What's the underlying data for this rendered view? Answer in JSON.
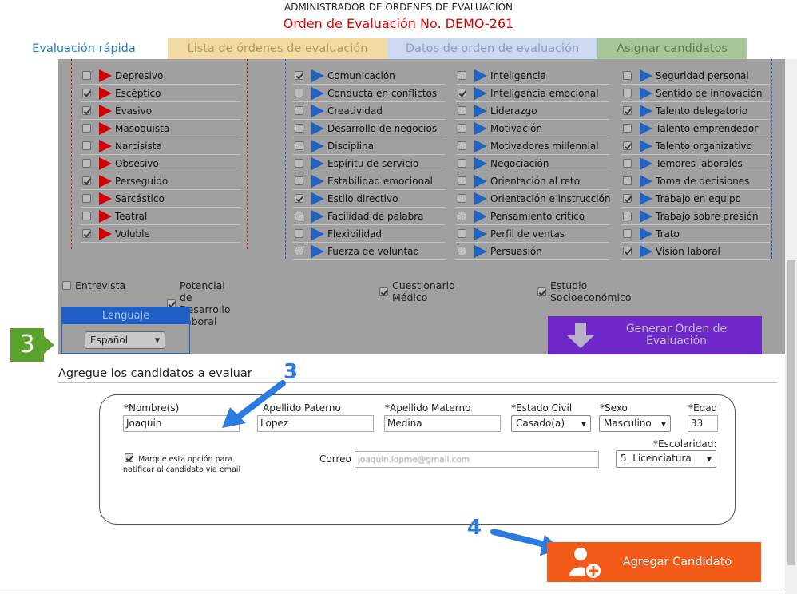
{
  "header": {
    "admin_title": "ADMINISTRADOR DE ORDENES DE EVALUACIÓN",
    "order_title": "Orden de Evaluación No. DEMO-261"
  },
  "tabs": [
    {
      "label": "Evaluación rápida"
    },
    {
      "label": "Lista de órdenes de evaluación"
    },
    {
      "label": "Datos de orden de evaluación"
    },
    {
      "label": "Asignar candidatos"
    }
  ],
  "traits_red": [
    {
      "label": "Depresivo",
      "checked": false
    },
    {
      "label": "Escéptico",
      "checked": true
    },
    {
      "label": "Evasivo",
      "checked": true
    },
    {
      "label": "Masoquista",
      "checked": false
    },
    {
      "label": "Narcisista",
      "checked": false
    },
    {
      "label": "Obsesivo",
      "checked": false
    },
    {
      "label": "Perseguido",
      "checked": true
    },
    {
      "label": "Sarcástico",
      "checked": false
    },
    {
      "label": "Teatral",
      "checked": false
    },
    {
      "label": "Voluble",
      "checked": true
    }
  ],
  "competencias_1": [
    {
      "label": "Comunicación",
      "checked": true
    },
    {
      "label": "Conducta en conflictos",
      "checked": false
    },
    {
      "label": "Creatividad",
      "checked": false
    },
    {
      "label": "Desarrollo de negocios",
      "checked": false
    },
    {
      "label": "Disciplina",
      "checked": false
    },
    {
      "label": "Espíritu de servicio",
      "checked": false
    },
    {
      "label": "Estabilidad emocional",
      "checked": false
    },
    {
      "label": "Estilo directivo",
      "checked": true
    },
    {
      "label": "Facilidad de palabra",
      "checked": false
    },
    {
      "label": "Flexibilidad",
      "checked": false
    },
    {
      "label": "Fuerza de voluntad",
      "checked": false
    }
  ],
  "competencias_2": [
    {
      "label": "Inteligencia",
      "checked": false
    },
    {
      "label": "Inteligencia emocional",
      "checked": true
    },
    {
      "label": "Liderazgo",
      "checked": false
    },
    {
      "label": "Motivación",
      "checked": false
    },
    {
      "label": "Motivadores millennial",
      "checked": false
    },
    {
      "label": "Negociación",
      "checked": false
    },
    {
      "label": "Orientación al reto",
      "checked": false
    },
    {
      "label": "Orientación e instrucción",
      "checked": false
    },
    {
      "label": "Pensamiento crítico",
      "checked": false
    },
    {
      "label": "Perfil de ventas",
      "checked": false
    },
    {
      "label": "Persuasión",
      "checked": false
    }
  ],
  "competencias_3": [
    {
      "label": "Seguridad personal",
      "checked": false
    },
    {
      "label": "Sentido de innovación",
      "checked": false
    },
    {
      "label": "Talento delegatorio",
      "checked": true
    },
    {
      "label": "Talento emprendedor",
      "checked": false
    },
    {
      "label": "Talento organizativo",
      "checked": true
    },
    {
      "label": "Temores laborales",
      "checked": false
    },
    {
      "label": "Toma de decisiones",
      "checked": false
    },
    {
      "label": "Trabajo en equipo",
      "checked": true
    },
    {
      "label": "Trabajo sobre presión",
      "checked": false
    },
    {
      "label": "Trato",
      "checked": false
    },
    {
      "label": "Visión laboral",
      "checked": true
    }
  ],
  "extras": [
    {
      "label": "Entrevista",
      "checked": false
    },
    {
      "label": "Potencial de Desarrollo Laboral",
      "checked": true
    },
    {
      "label": "Cuestionario Médico",
      "checked": true
    },
    {
      "label": "Estudio Socioeconómico",
      "checked": true
    }
  ],
  "language": {
    "title": "Lenguaje",
    "value": "Español"
  },
  "generate_button": {
    "line1": "Generar Orden de",
    "line2": "Evaluación"
  },
  "step_badge": "3",
  "candidates_section": {
    "title": "Agregue los candidatos a evaluar"
  },
  "form": {
    "nombre_label": "*Nombre(s)",
    "nombre_value": "Joaquin",
    "paterno_label": "Apellido Paterno",
    "paterno_value": "Lopez",
    "materno_label": "*Apellido Materno",
    "materno_value": "Medina",
    "civil_label": "*Estado Civil",
    "civil_value": "Casado(a)",
    "sexo_label": "*Sexo",
    "sexo_value": "Masculino",
    "edad_label": "*Edad",
    "edad_value": "33",
    "escolaridad_label": "*Escolaridad:",
    "escolaridad_value": "5. Licenciatura",
    "correo_label": "Correo",
    "correo_value": "joaquin.lopme@gmail.com",
    "notify_line1": "Marque esta opción para",
    "notify_line2": "notificar al candidato vía email",
    "notify_checked": true
  },
  "annotations": {
    "arrow_num_3": "3",
    "arrow_num_4": "4"
  },
  "add_button": {
    "label": "Agregar Candidato"
  },
  "colors": {
    "tab_active": "#1f7ac2",
    "generate_bg": "#6e28c8",
    "add_bg": "#f25a1a",
    "badge_bg": "#5aa32a",
    "arrow_blue": "#2b7be0"
  }
}
